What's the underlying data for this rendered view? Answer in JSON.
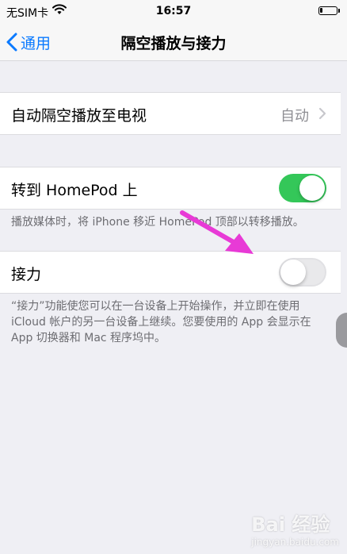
{
  "status_bar": {
    "carrier": "无SIM卡",
    "time": "16:57",
    "battery_level": 0.15
  },
  "nav": {
    "back_label": "通用",
    "title": "隔空播放与接力"
  },
  "airplay": {
    "label": "自动隔空播放至电视",
    "value": "自动"
  },
  "homepod": {
    "label": "转到 HomePod 上",
    "enabled": true,
    "note": "播放媒体时，将 iPhone 移近 HomePod 顶部以转移播放。"
  },
  "handoff": {
    "label": "接力",
    "enabled": false,
    "note": "“接力”功能使您可以在一台设备上开始操作，并立即在使用 iCloud 帐户的另一台设备上继续。您要使用的 App 会显示在 App 切换器和 Mac 程序坞中。"
  },
  "colors": {
    "accent": "#0a7aff",
    "switch_on": "#34c759",
    "annotation_arrow": "#e83ad6"
  },
  "watermark": {
    "text": "Bai 经验",
    "sub": "jingyan.baidu.com"
  }
}
